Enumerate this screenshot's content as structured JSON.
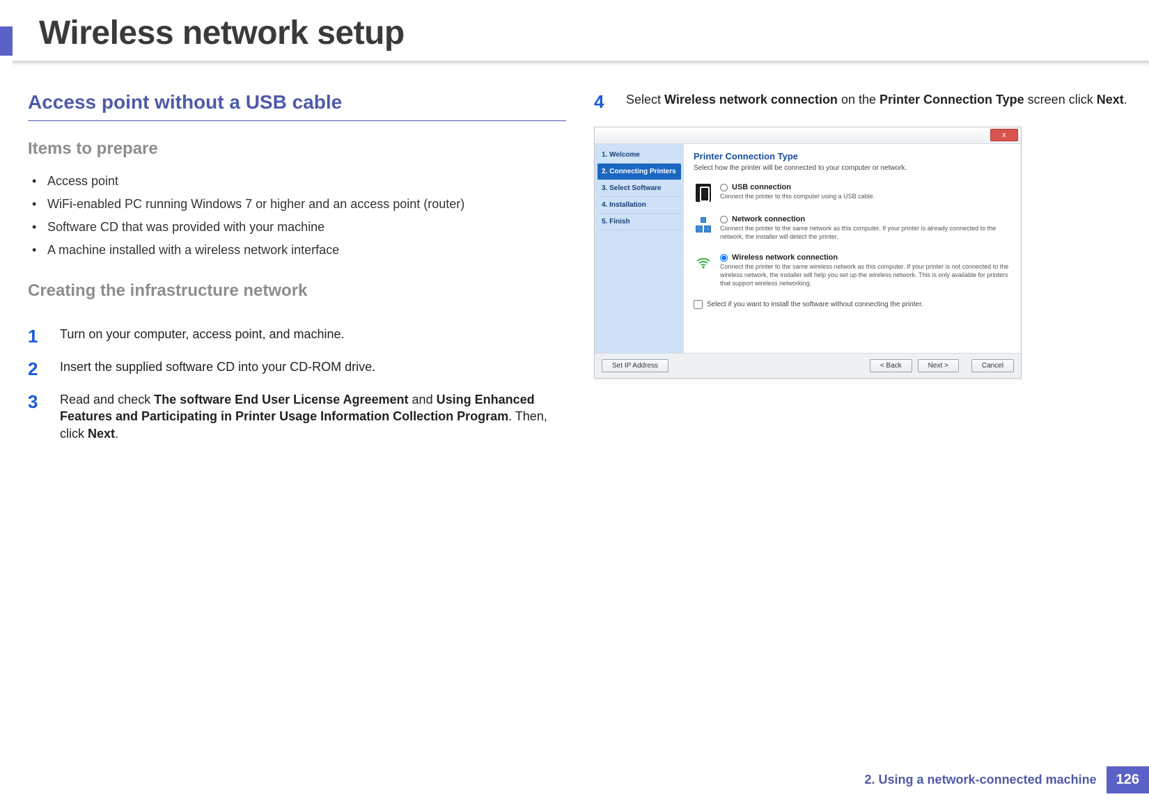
{
  "title": "Wireless network setup",
  "footer": {
    "chapter": "2.  Using a network-connected machine",
    "page": "126"
  },
  "left": {
    "section_heading": "Access point without a USB cable",
    "items_heading": "Items to prepare",
    "items": [
      "Access point",
      "WiFi-enabled PC running Windows 7 or higher and an access point (router)",
      "Software CD that was provided with your machine",
      "A machine installed with a wireless network interface"
    ],
    "infra_heading": "Creating the infrastructure network",
    "steps": {
      "s1": {
        "num": "1",
        "text": "Turn on your computer, access point, and machine."
      },
      "s2": {
        "num": "2",
        "text": "Insert the supplied software CD into your CD-ROM drive."
      },
      "s3": {
        "num": "3",
        "pre": "Read and check ",
        "b1": "The software End User License Agreement",
        "mid": " and ",
        "b2": "Using Enhanced Features and Participating in Printer Usage Information Collection Program",
        "post1": ". Then, click ",
        "b3": "Next",
        "post2": "."
      }
    }
  },
  "right": {
    "step4": {
      "num": "4",
      "pre": "Select ",
      "b1": "Wireless network connection",
      "mid1": " on the ",
      "b2": "Printer Connection Type",
      "mid2": " screen click ",
      "b3": "Next",
      "post": "."
    },
    "dialog": {
      "close": "x",
      "side": {
        "i1": "1. Welcome",
        "i2": "2. Connecting Printers",
        "i3": "3. Select Software",
        "i4": "4. Installation",
        "i5": "5. Finish"
      },
      "heading": "Printer Connection Type",
      "sub": "Select how the printer will be connected to your computer or network.",
      "opt_usb": {
        "title": "USB connection",
        "desc": "Connect the printer to this computer using a USB cable."
      },
      "opt_net": {
        "title": "Network connection",
        "desc": "Connect the printer to the same network as this computer.\nIf your printer is already connected to the network, the installer will detect the printer."
      },
      "opt_wifi": {
        "title": "Wireless network connection",
        "desc": "Connect the printer to the same wireless network as this computer.\nIf your printer is not connected to the wireless network, the installer will help you set up the wireless network. This is only available for printers that support wireless networking."
      },
      "checkbox": "Select if you want to install the software without connecting the printer.",
      "buttons": {
        "setip": "Set IP Address",
        "back": "< Back",
        "next": "Next >",
        "cancel": "Cancel"
      }
    }
  }
}
